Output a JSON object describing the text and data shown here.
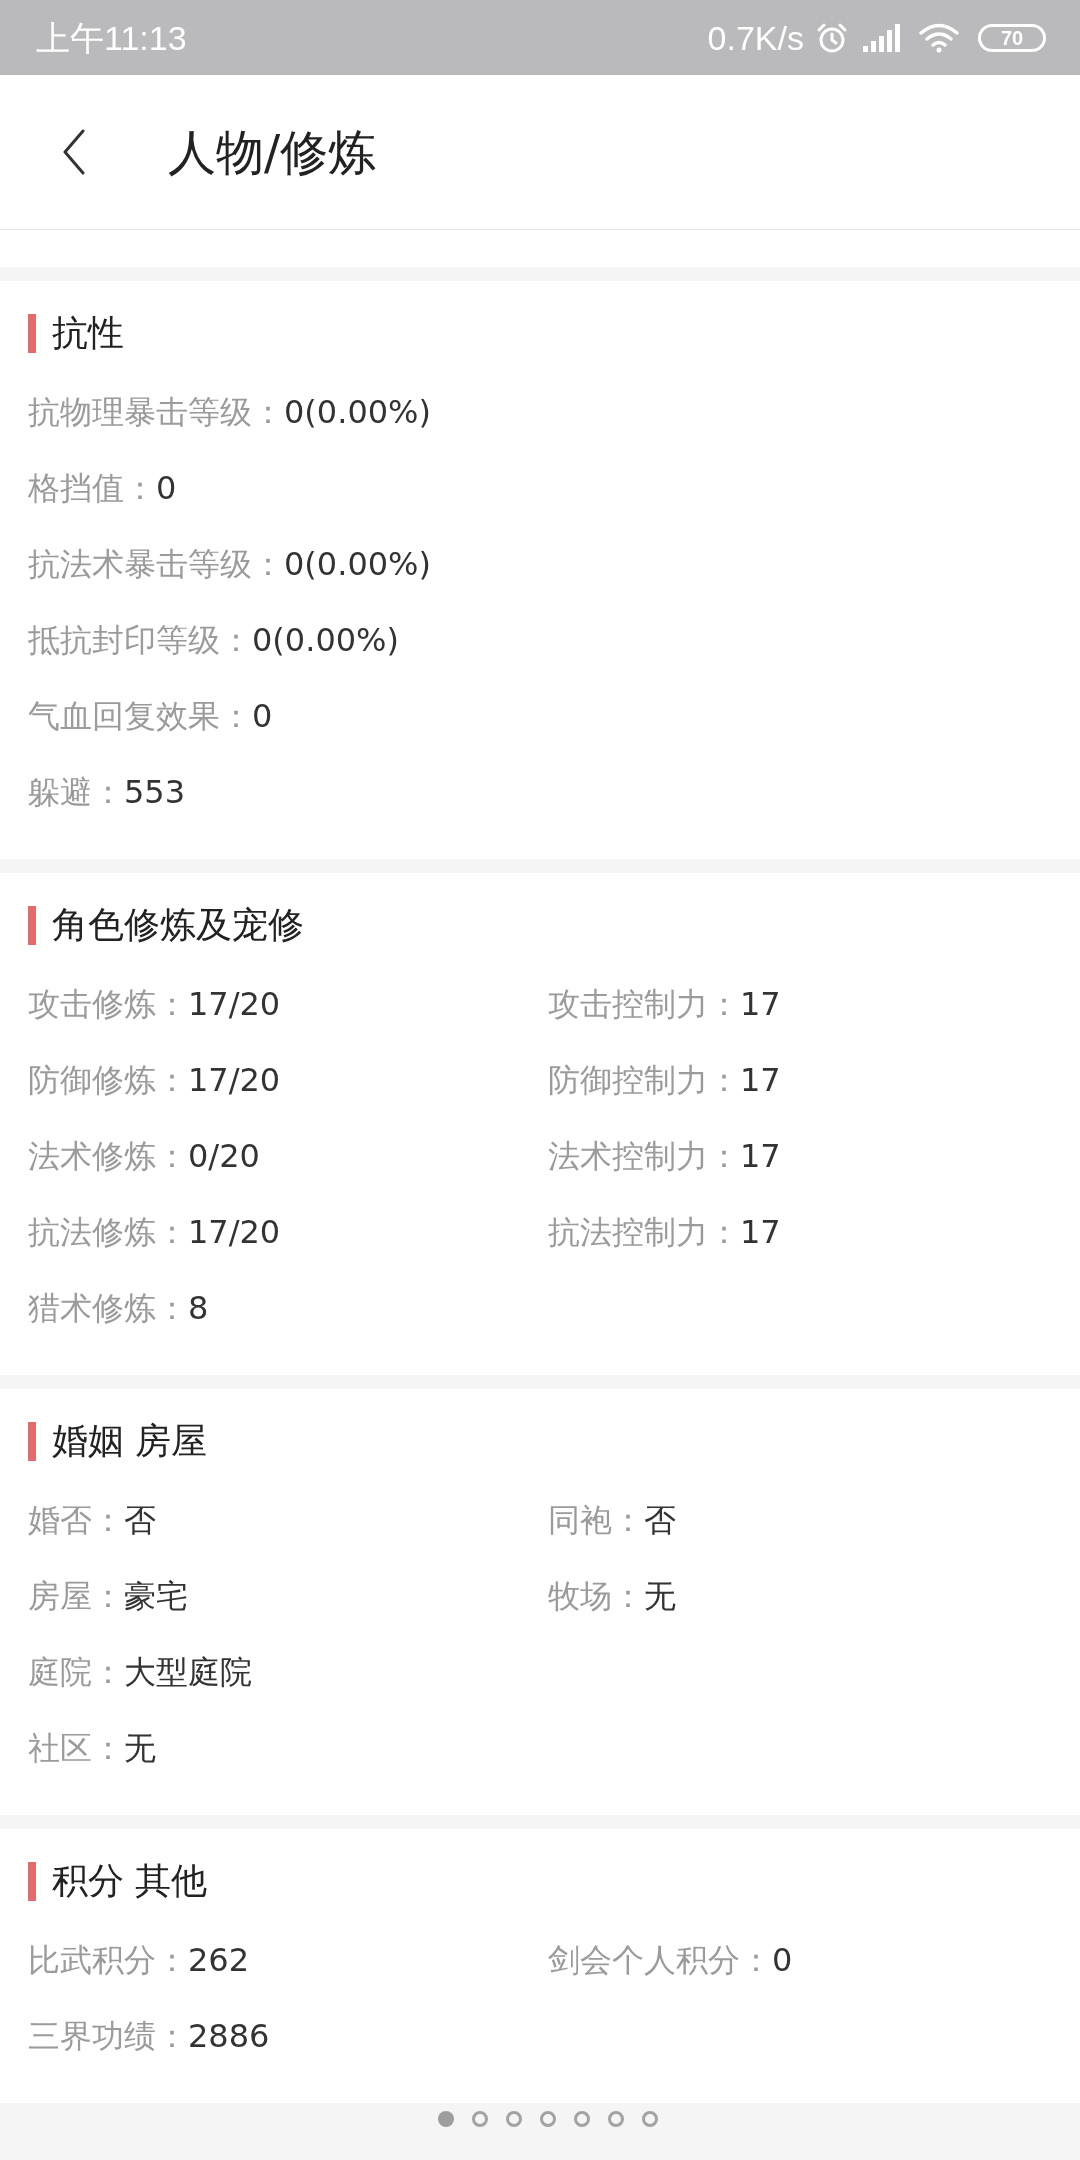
{
  "status_bar": {
    "time": "上午11:13",
    "net_speed": "0.7K/s",
    "battery": "70"
  },
  "header": {
    "title": "人物/修炼"
  },
  "sections": [
    {
      "title": "抗性",
      "rows": [
        [
          {
            "label": "抗物理暴击等级：",
            "value": "0(0.00%)"
          }
        ],
        [
          {
            "label": "格挡值：",
            "value": "0"
          }
        ],
        [
          {
            "label": "抗法术暴击等级：",
            "value": "0(0.00%)"
          }
        ],
        [
          {
            "label": "抵抗封印等级：",
            "value": "0(0.00%)"
          }
        ],
        [
          {
            "label": "气血回复效果：",
            "value": "0"
          }
        ],
        [
          {
            "label": "躲避：",
            "value": "553"
          }
        ]
      ]
    },
    {
      "title": "角色修炼及宠修",
      "rows": [
        [
          {
            "label": "攻击修炼：",
            "value": "17/20"
          },
          {
            "label": "攻击控制力：",
            "value": "17"
          }
        ],
        [
          {
            "label": "防御修炼：",
            "value": "17/20"
          },
          {
            "label": "防御控制力：",
            "value": "17"
          }
        ],
        [
          {
            "label": "法术修炼：",
            "value": "0/20"
          },
          {
            "label": "法术控制力：",
            "value": "17"
          }
        ],
        [
          {
            "label": "抗法修炼：",
            "value": "17/20"
          },
          {
            "label": "抗法控制力：",
            "value": "17"
          }
        ],
        [
          {
            "label": "猎术修炼：",
            "value": "8"
          }
        ]
      ]
    },
    {
      "title": "婚姻 房屋",
      "rows": [
        [
          {
            "label": "婚否：",
            "value": "否"
          },
          {
            "label": "同袍：",
            "value": "否"
          }
        ],
        [
          {
            "label": "房屋：",
            "value": "豪宅"
          },
          {
            "label": "牧场：",
            "value": "无"
          }
        ],
        [
          {
            "label": "庭院：",
            "value": "大型庭院"
          }
        ],
        [
          {
            "label": "社区：",
            "value": "无"
          }
        ]
      ]
    },
    {
      "title": "积分 其他",
      "rows": [
        [
          {
            "label": "比武积分：",
            "value": "262"
          },
          {
            "label": "剑会个人积分：",
            "value": "0"
          }
        ],
        [
          {
            "label": "三界功绩：",
            "value": "2886"
          }
        ]
      ]
    }
  ],
  "pager": {
    "dots": [
      {
        "selected": true
      },
      {
        "selected": false
      },
      {
        "selected": false
      },
      {
        "selected": false
      },
      {
        "selected": false
      },
      {
        "selected": false
      },
      {
        "selected": false
      }
    ]
  }
}
